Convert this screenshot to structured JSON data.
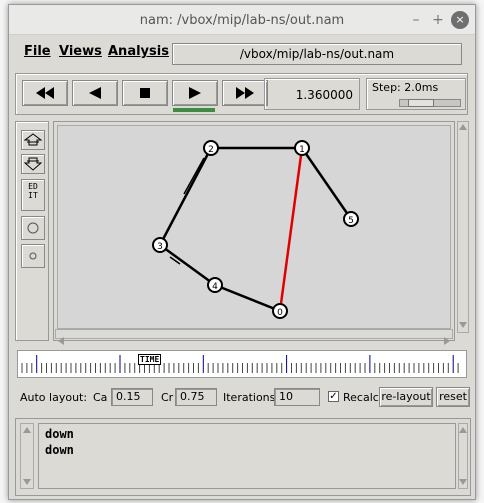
{
  "window": {
    "title": "nam: /vbox/mip/lab-ns/out.nam",
    "minimize": "–",
    "maximize": "+",
    "close": "×"
  },
  "menu": {
    "file": "File",
    "views": "Views",
    "analysis": "Analysis",
    "path": "/vbox/mip/lab-ns/out.nam"
  },
  "controls": {
    "buttons": [
      "rewind-fast",
      "rewind",
      "stop",
      "play",
      "fast-forward"
    ],
    "time": "1.360000",
    "step_label": "Step: 2.0ms",
    "step_slider_fraction": 0.5,
    "accent_color": "#3d8c40"
  },
  "tools": {
    "edit_label": "EDIT"
  },
  "network": {
    "nodes": [
      {
        "id": "2"
      },
      {
        "id": "1"
      },
      {
        "id": "5"
      },
      {
        "id": "3"
      },
      {
        "id": "4"
      },
      {
        "id": "0"
      }
    ],
    "link_colors": {
      "normal": "#000000",
      "active": "#e00000"
    }
  },
  "timeline": {
    "label": "TIME"
  },
  "layout": {
    "auto_layout_label": "Auto layout:",
    "ca_label": "Ca",
    "ca_value": "0.15",
    "cr_label": "Cr",
    "cr_value": "0.75",
    "iterations_label": "Iterations",
    "iterations_value": "10",
    "recalc_label": "Recalc",
    "recalc_checked": true,
    "relayout_label": "re-layout",
    "reset_label": "reset"
  },
  "annotation": {
    "lines": [
      "down",
      "down"
    ]
  }
}
